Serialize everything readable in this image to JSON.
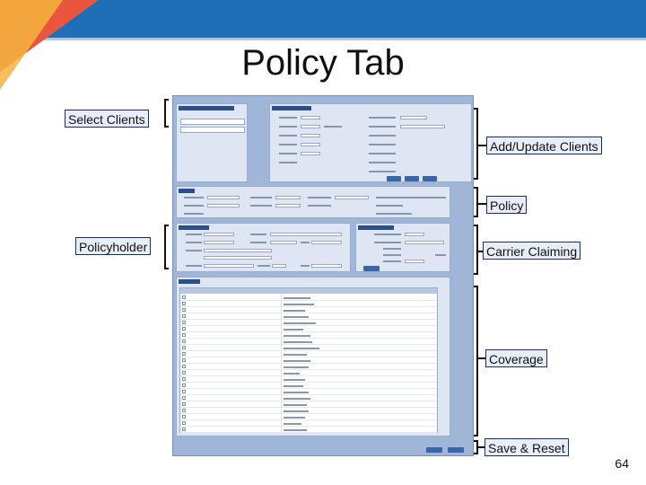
{
  "slide": {
    "title": "Policy Tab",
    "page_number": "64"
  },
  "callouts": {
    "select_clients": "Select Clients",
    "add_update_clients": "Add/Update Clients",
    "policy": "Policy",
    "policyholder": "Policyholder",
    "carrier_claiming": "Carrier Claiming",
    "coverage": "Coverage",
    "save_reset": "Save & Reset"
  },
  "colors": {
    "header_blue": "#1e6fb5",
    "accent_red": "#e9563b",
    "accent_orange": "#f5b440",
    "callout_fill": "#e8eef8",
    "callout_border": "#1b2c6b"
  }
}
